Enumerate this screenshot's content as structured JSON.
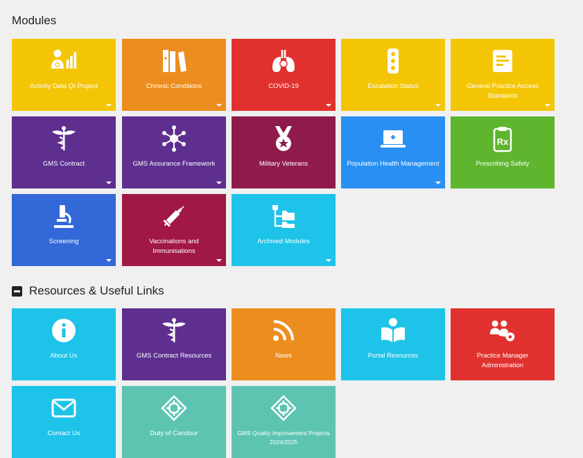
{
  "modules": {
    "title": "Modules",
    "tiles": [
      {
        "label": "Activity Data QI Project",
        "icon": "doctor-chart-icon",
        "color": "#f4c505",
        "dropdown": true
      },
      {
        "label": "Chronic Conditions",
        "icon": "medicine-books-icon",
        "color": "#ec8e1f",
        "dropdown": true
      },
      {
        "label": "COVID-19",
        "icon": "virus-lungs-icon",
        "color": "#e0312e",
        "dropdown": true
      },
      {
        "label": "Escalation Status",
        "icon": "traffic-light-icon",
        "color": "#f4c505",
        "dropdown": true
      },
      {
        "label": "General Practice Access Standards",
        "icon": "document-icon",
        "color": "#f4c505",
        "dropdown": true
      },
      {
        "label": "GMS Contract",
        "icon": "caduceus-icon",
        "color": "#5e2f8f",
        "dropdown": true
      },
      {
        "label": "GMS Assurance Framework",
        "icon": "network-icon",
        "color": "#5e2f8f",
        "dropdown": true
      },
      {
        "label": "Military Veterans",
        "icon": "medal-icon",
        "color": "#8f1b4d",
        "dropdown": false
      },
      {
        "label": "Population Health Management",
        "icon": "laptop-medical-icon",
        "color": "#2a8ff2",
        "dropdown": true
      },
      {
        "label": "Prescribing Safety",
        "icon": "prescription-icon",
        "color": "#5fb52d",
        "dropdown": false
      },
      {
        "label": "Screening",
        "icon": "microscope-icon",
        "color": "#3268d8",
        "dropdown": true
      },
      {
        "label": "Vaccinations and Immunisations",
        "icon": "syringe-icon",
        "color": "#a11844",
        "dropdown": true
      },
      {
        "label": "Archived Modules",
        "icon": "folder-tree-icon",
        "color": "#1dc3e9",
        "dropdown": true
      }
    ]
  },
  "resources": {
    "title": "Resources & Useful Links",
    "tiles": [
      {
        "label": "About Us",
        "icon": "info-icon",
        "color": "#1dc3e9"
      },
      {
        "label": "GMS Contract Resources",
        "icon": "caduceus-icon",
        "color": "#5e2f8f"
      },
      {
        "label": "News",
        "icon": "rss-icon",
        "color": "#ec8e1f"
      },
      {
        "label": "Portal Resources",
        "icon": "reader-icon",
        "color": "#1dc3e9"
      },
      {
        "label": "Practice Manager Administration",
        "icon": "users-gear-icon",
        "color": "#e0312e"
      },
      {
        "label": "Contact Us",
        "icon": "envelope-icon",
        "color": "#1dc3e9"
      },
      {
        "label": "Duty of Candour",
        "icon": "crosshair-icon",
        "color": "#5dc4b2"
      },
      {
        "label": "GMS Quality Improvement Projects 2024/2025",
        "icon": "crosshair-icon",
        "color": "#5dc4b2"
      }
    ]
  }
}
